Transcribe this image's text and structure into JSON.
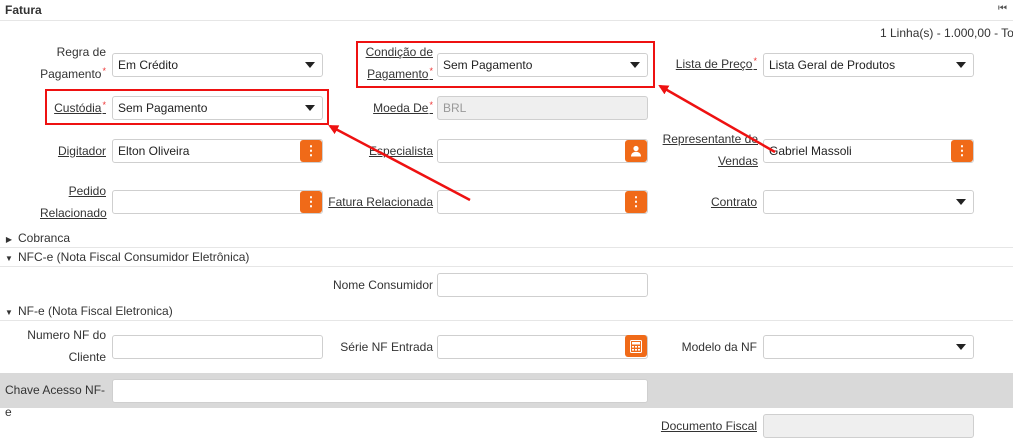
{
  "header": {
    "title": "Fatura",
    "collapse_icon": "collapse-icon"
  },
  "row_info": "1 Linha(s) - 1.000,00 - Tot",
  "fields": {
    "regra_pagamento": {
      "label_line1": "Regra de",
      "label_line2": "Pagamento",
      "required": "*",
      "value": "Em Crédito"
    },
    "condicao_pagamento": {
      "label_line1": "Condição de",
      "label_line2": "Pagamento",
      "required": "*",
      "value": "Sem Pagamento"
    },
    "lista_preco": {
      "label": "Lista de Preço",
      "required": "*",
      "value": "Lista Geral de Produtos"
    },
    "custodia": {
      "label": "Custódia",
      "required": "*",
      "value": "Sem Pagamento"
    },
    "moeda": {
      "label": "Moeda De",
      "required": "*",
      "value": "BRL"
    },
    "digitador": {
      "label": "Digitador",
      "value": "Elton Oliveira"
    },
    "especialista": {
      "label": "Especialista",
      "value": ""
    },
    "representante": {
      "label_line1": "Representante de",
      "label_line2": "Vendas",
      "value": "Gabriel Massoli"
    },
    "pedido_relacionado": {
      "label_line1": "Pedido",
      "label_line2": "Relacionado",
      "value": ""
    },
    "fatura_relacionada": {
      "label": "Fatura Relacionada",
      "value": ""
    },
    "contrato": {
      "label": "Contrato",
      "value": ""
    }
  },
  "sections": {
    "cobranca": "Cobranca",
    "nfce": "NFC-e (Nota Fiscal Consumidor Eletrônica)",
    "nfe": "NF-e (Nota Fiscal Eletronica)"
  },
  "nfce_fields": {
    "nome_consumidor": {
      "label": "Nome Consumidor",
      "value": ""
    }
  },
  "nfe_fields": {
    "numero_nf_cliente": {
      "label_line1": "Numero NF do",
      "label_line2": "Cliente",
      "value": ""
    },
    "serie_nf_entrada": {
      "label": "Série NF Entrada",
      "value": ""
    },
    "modelo_nf": {
      "label": "Modelo da NF",
      "value": ""
    },
    "chave_acesso": {
      "label": "Chave Acesso NF-e",
      "value": ""
    },
    "documento_fiscal": {
      "label": "Documento Fiscal",
      "value": ""
    }
  },
  "colors": {
    "accent": "#f06a18",
    "highlight": "#e11111",
    "required": "#e33333"
  }
}
